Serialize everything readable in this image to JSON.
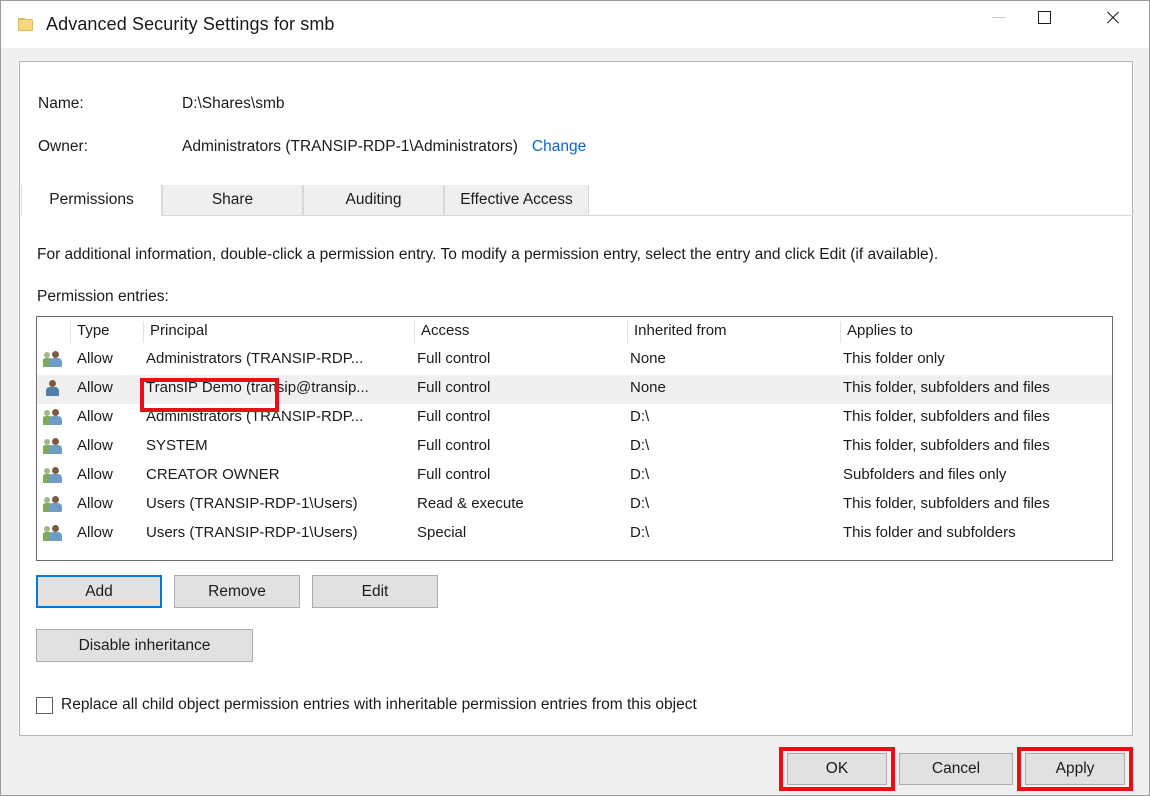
{
  "window": {
    "title": "Advanced Security Settings for smb",
    "icon": "folder-icon",
    "caption_buttons": {
      "minimize": "minimize-icon",
      "maximize": "maximize-icon",
      "close": "close-icon"
    }
  },
  "header": {
    "name_label": "Name:",
    "name_value": "D:\\Shares\\smb",
    "owner_label": "Owner:",
    "owner_value": "Administrators (TRANSIP-RDP-1\\Administrators)",
    "owner_change_link": "Change"
  },
  "tabs": [
    {
      "label": "Permissions",
      "active": true
    },
    {
      "label": "Share",
      "active": false
    },
    {
      "label": "Auditing",
      "active": false
    },
    {
      "label": "Effective Access",
      "active": false
    }
  ],
  "content": {
    "info_text": "For additional information, double-click a permission entry. To modify a permission entry, select the entry and click Edit (if available).",
    "entries_label": "Permission entries:"
  },
  "table": {
    "columns": [
      "Type",
      "Principal",
      "Access",
      "Inherited from",
      "Applies to"
    ],
    "rows": [
      {
        "icon": "group-icon",
        "type": "Allow",
        "principal": "Administrators (TRANSIP-RDP...",
        "access": "Full control",
        "inherited_from": "None",
        "applies_to": "This folder only",
        "selected": false
      },
      {
        "icon": "user-icon",
        "type": "Allow",
        "principal": "TransIP Demo (transip@transip...",
        "access": "Full control",
        "inherited_from": "None",
        "applies_to": "This folder, subfolders and files",
        "selected": true
      },
      {
        "icon": "group-icon",
        "type": "Allow",
        "principal": "Administrators (TRANSIP-RDP...",
        "access": "Full control",
        "inherited_from": "D:\\",
        "applies_to": "This folder, subfolders and files",
        "selected": false
      },
      {
        "icon": "group-icon",
        "type": "Allow",
        "principal": "SYSTEM",
        "access": "Full control",
        "inherited_from": "D:\\",
        "applies_to": "This folder, subfolders and files",
        "selected": false
      },
      {
        "icon": "group-icon",
        "type": "Allow",
        "principal": "CREATOR OWNER",
        "access": "Full control",
        "inherited_from": "D:\\",
        "applies_to": "Subfolders and files only",
        "selected": false
      },
      {
        "icon": "group-icon",
        "type": "Allow",
        "principal": "Users (TRANSIP-RDP-1\\Users)",
        "access": "Read & execute",
        "inherited_from": "D:\\",
        "applies_to": "This folder, subfolders and files",
        "selected": false
      },
      {
        "icon": "group-icon",
        "type": "Allow",
        "principal": "Users (TRANSIP-RDP-1\\Users)",
        "access": "Special",
        "inherited_from": "D:\\",
        "applies_to": "This folder and subfolders",
        "selected": false
      }
    ]
  },
  "buttons": {
    "add": "Add",
    "remove": "Remove",
    "edit": "Edit",
    "disable_inheritance": "Disable inheritance"
  },
  "checkbox": {
    "label": "Replace all child object permission entries with inheritable permission entries from this object",
    "checked": false
  },
  "footer": {
    "ok": "OK",
    "cancel": "Cancel",
    "apply": "Apply"
  },
  "annotations": {
    "color": "#e81010",
    "boxes": [
      "principal-cell-transip-demo",
      "ok-button",
      "apply-button"
    ]
  },
  "colors": {
    "link": "#0a64c8",
    "focus_border": "#0078d7",
    "annotation_red": "#e81010",
    "button_face": "#e1e1e1",
    "dialog_background": "#f0f0f0"
  }
}
